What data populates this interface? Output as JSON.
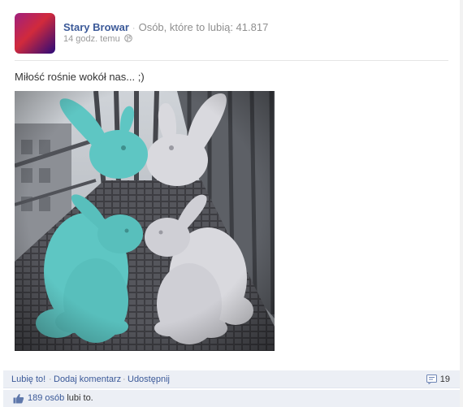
{
  "post": {
    "page_name": "Stary Browar",
    "likes_label": "Osób, które to lubią: 41.817",
    "timestamp": "14 godz. temu",
    "message": "Miłość rośnie wokół nas... ;)",
    "photo_icon": "easter-bunnies-photo"
  },
  "actions": {
    "like": "Lubię to!",
    "comment": "Dodaj komentarz",
    "share": "Udostępnij",
    "comment_count": "19"
  },
  "likes": {
    "count_link": "189 osób",
    "rest": "lubi to."
  },
  "colors": {
    "link": "#3b5998",
    "bar_bg": "#eceff5",
    "turquoise_bunny": "#5ec6c3",
    "white_bunny": "#d9d9de"
  }
}
